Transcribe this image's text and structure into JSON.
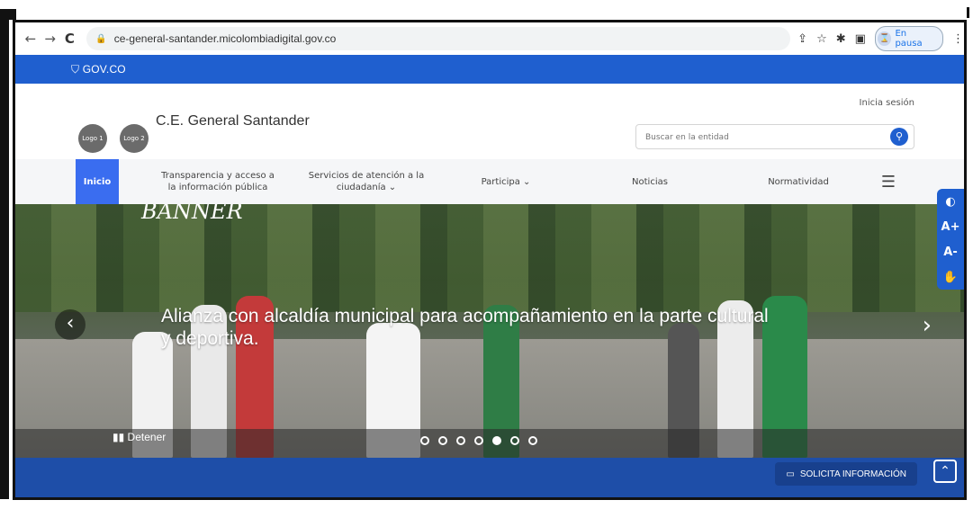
{
  "browser": {
    "url": "ce-general-santander.micolombiadigital.gov.co",
    "profile_status": "En pausa",
    "icons": [
      "back-icon",
      "forward-icon",
      "reload-icon",
      "lock-icon",
      "share-icon",
      "star-icon",
      "extensions-icon",
      "sidepanel-icon",
      "menu-icon"
    ]
  },
  "govbar": {
    "label": "GOV.CO"
  },
  "header": {
    "logo1": "Logo 1",
    "logo2": "Logo 2",
    "title": "C.E. General Santander",
    "login": "Inicia sesión",
    "search_placeholder": "Buscar en la entidad"
  },
  "menu": {
    "inicio": "Inicio",
    "transparencia_line1": "Transparencia y acceso a",
    "transparencia_line2": "la información pública",
    "servicios_line1": "Servicios de atención a la",
    "servicios_line2": "ciudadanía ⌄",
    "participa": "Participa ⌄",
    "noticias": "Noticias",
    "normatividad": "Normatividad"
  },
  "banner": {
    "label": "BANNER",
    "caption": "Alianza con alcaldía municipal para acompañamiento en la parte cultural y deportiva.",
    "stop": "Detener",
    "total_slides": 7,
    "active_slide": 5
  },
  "accessibility": {
    "contrast": "◐",
    "increase": "A+",
    "decrease": "A-",
    "sign": "✋"
  },
  "footer": {
    "solicita": "SOLICITA INFORMACIÓN"
  },
  "colors": {
    "gov_blue": "#1f5fcf",
    "menu_active": "#3a6df0",
    "footer_blue": "#1e4ea8"
  }
}
